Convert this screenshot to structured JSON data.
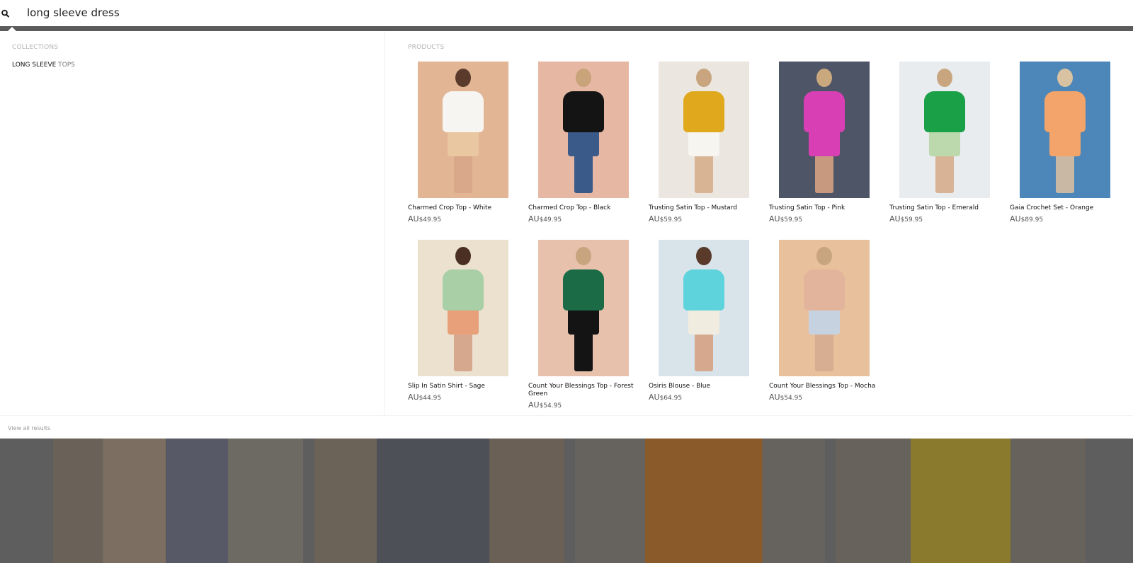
{
  "search": {
    "query": "long sleeve dress"
  },
  "collections": {
    "heading": "COLLECTIONS",
    "items": [
      {
        "highlight": "LONG SLEEVE",
        "rest": " TOPS"
      }
    ]
  },
  "products": {
    "heading": "PRODUCTS",
    "items": [
      {
        "title": "Charmed Crop Top - White",
        "currency": "AU",
        "price": "$49.95"
      },
      {
        "title": "Charmed Crop Top - Black",
        "currency": "AU",
        "price": "$49.95"
      },
      {
        "title": "Trusting Satin Top - Mustard",
        "currency": "AU",
        "price": "$59.95"
      },
      {
        "title": "Trusting Satin Top - Pink",
        "currency": "AU",
        "price": "$59.95"
      },
      {
        "title": "Trusting Satin Top - Emerald",
        "currency": "AU",
        "price": "$59.95"
      },
      {
        "title": "Gaia Crochet Set - Orange",
        "currency": "AU",
        "price": "$89.95"
      },
      {
        "title": "Slip In Satin Shirt - Sage",
        "currency": "AU",
        "price": "$44.95"
      },
      {
        "title": "Count Your Blessings Top - Forest Green",
        "currency": "AU",
        "price": "$54.95"
      },
      {
        "title": "Osiris Blouse - Blue",
        "currency": "AU",
        "price": "$64.95"
      },
      {
        "title": "Count Your Blessings Top - Mocha",
        "currency": "AU",
        "price": "$54.95"
      }
    ]
  },
  "footer": {
    "view_all": "View all results"
  },
  "colors": {
    "divider": "#5b5b5b",
    "heading_grey": "#b3b3b3"
  }
}
